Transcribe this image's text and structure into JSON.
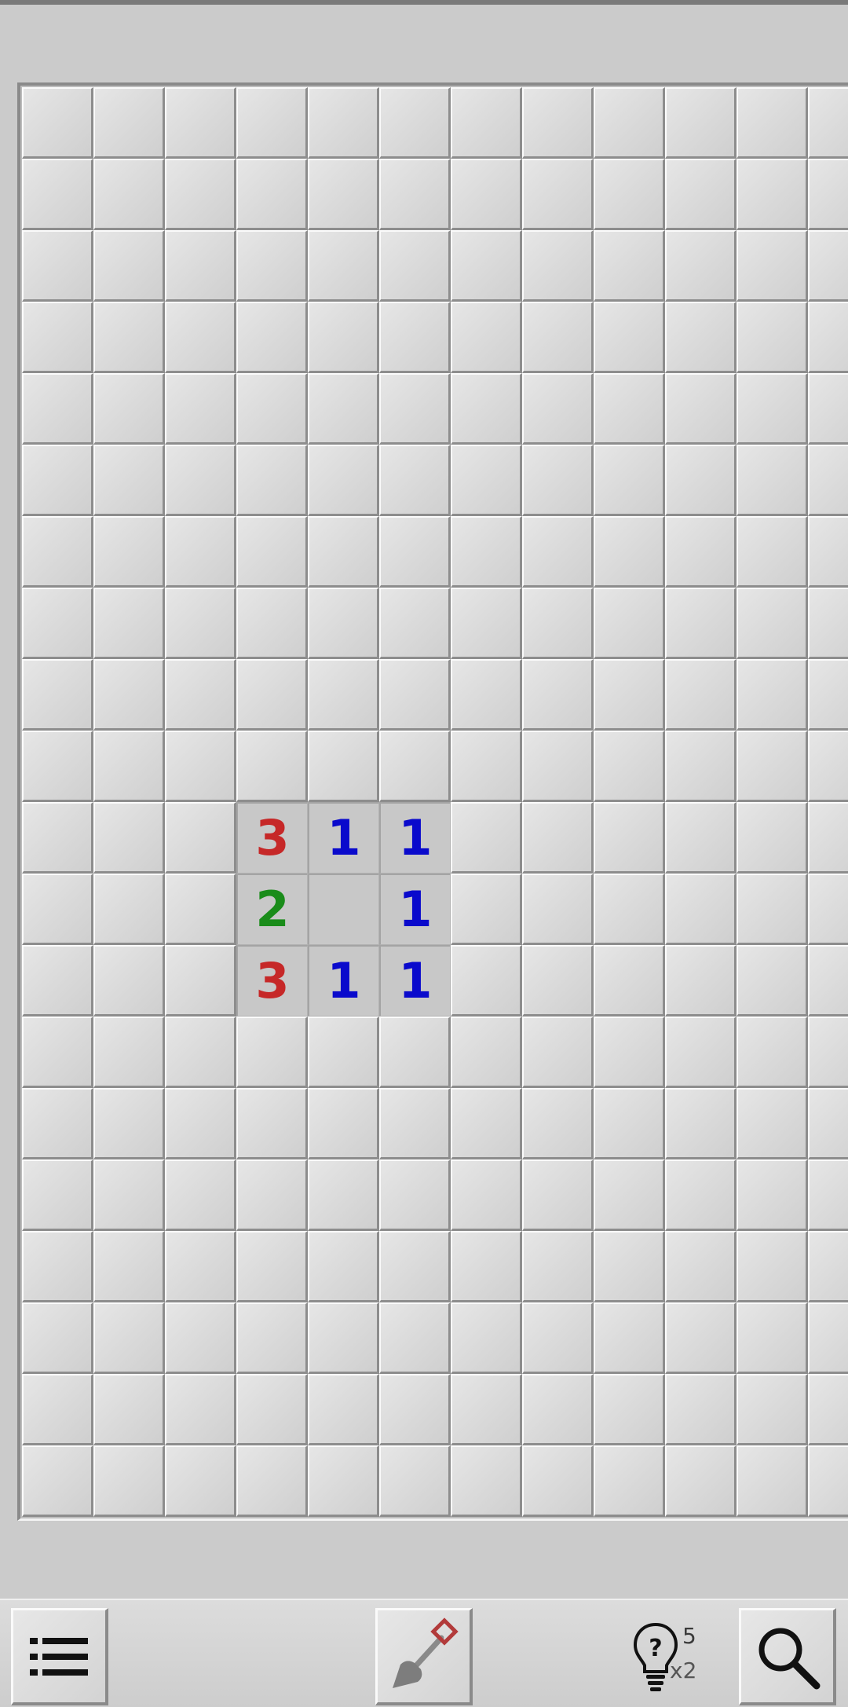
{
  "board": {
    "rows": 20,
    "visible_columns": 12,
    "number_colors": {
      "1": "#0a0acc",
      "2": "#1a8c1a",
      "3": "#c62828"
    },
    "opened_cells": [
      {
        "row": 10,
        "col": 3,
        "value": "3"
      },
      {
        "row": 10,
        "col": 4,
        "value": "1"
      },
      {
        "row": 10,
        "col": 5,
        "value": "1"
      },
      {
        "row": 11,
        "col": 3,
        "value": "2"
      },
      {
        "row": 11,
        "col": 4,
        "value": ""
      },
      {
        "row": 11,
        "col": 5,
        "value": "1"
      },
      {
        "row": 12,
        "col": 3,
        "value": "3"
      },
      {
        "row": 12,
        "col": 4,
        "value": "1"
      },
      {
        "row": 12,
        "col": 5,
        "value": "1"
      }
    ]
  },
  "toolbar": {
    "menu_icon": "list-icon",
    "mode_icon": "shovel-icon",
    "hint_icon": "lightbulb-question-icon",
    "hint_count": "5",
    "hint_multiplier": "x2",
    "zoom_icon": "magnifier-icon"
  }
}
